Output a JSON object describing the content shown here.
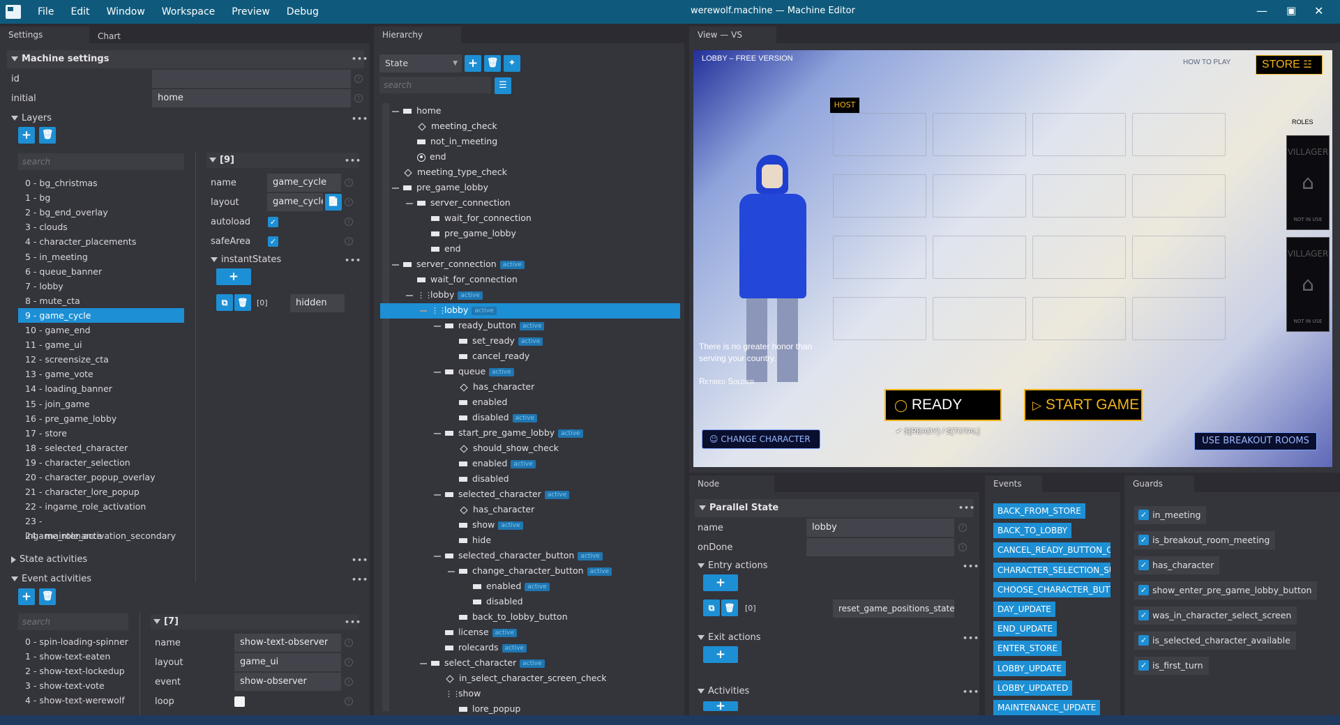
{
  "app": {
    "title": "werewolf.machine — Machine Editor",
    "menu": [
      "File",
      "Edit",
      "Window",
      "Workspace",
      "Preview",
      "Debug"
    ]
  },
  "left": {
    "tabs": [
      "Settings",
      "Chart"
    ],
    "section": "Machine settings",
    "id_label": "id",
    "id_value": "",
    "initial_label": "initial",
    "initial_value": "home",
    "layers_title": "Layers",
    "search_placeholder": "search",
    "layers": [
      "0 - bg_christmas",
      "1 - bg",
      "2 - bg_end_overlay",
      "3 - clouds",
      "4 - character_placements",
      "5 - in_meeting",
      "6 - queue_banner",
      "7 - lobby",
      "8 - mute_cta",
      "9 - game_cycle",
      "10 - game_end",
      "11 - game_ui",
      "12 - screensize_cta",
      "13 - game_vote",
      "14 - loading_banner",
      "15 - join_game",
      "16 - pre_game_lobby",
      "17 - store",
      "18 - selected_character",
      "19 - character_selection",
      "20 - character_popup_overlay",
      "21 - character_lore_popup",
      "22 - ingame_role_activation",
      "23 - ingame_role_activation_secondary",
      "24 - maintenance"
    ],
    "layer_detail": {
      "index": "[9]",
      "name_label": "name",
      "name_value": "game_cycle",
      "layout_label": "layout",
      "layout_value": "game_cycle.",
      "autoload_label": "autoload",
      "safearea_label": "safeArea",
      "instant_label": "instantStates",
      "instant_index": "[0]",
      "instant_value": "hidden"
    },
    "state_activities": "State activities",
    "event_activities": "Event activities",
    "event_list": [
      "0 - spin-loading-spinner",
      "1 - show-text-eaten",
      "2 - show-text-lockedup",
      "3 - show-text-vote",
      "4 - show-text-werewolf"
    ],
    "event_detail": {
      "index": "[7]",
      "name_label": "name",
      "name_value": "show-text-observer",
      "layout_label": "layout",
      "layout_value": "game_ui",
      "event_label": "event",
      "event_value": "show-observer",
      "loop_label": "loop"
    }
  },
  "hierarchy": {
    "tab": "Hierarchy",
    "select": "State",
    "search_placeholder": "search",
    "nodes": [
      {
        "t": "home",
        "d": 0,
        "i": "box",
        "c": "min"
      },
      {
        "t": "meeting_check",
        "d": 1,
        "i": "dia"
      },
      {
        "t": "not_in_meeting",
        "d": 1,
        "i": "box"
      },
      {
        "t": "end",
        "d": 1,
        "i": "fin"
      },
      {
        "t": "meeting_type_check",
        "d": 0,
        "i": "dia"
      },
      {
        "t": "pre_game_lobby",
        "d": 0,
        "i": "box",
        "c": "min"
      },
      {
        "t": "server_connection",
        "d": 1,
        "i": "box",
        "c": "min"
      },
      {
        "t": "wait_for_connection",
        "d": 2,
        "i": "box"
      },
      {
        "t": "pre_game_lobby",
        "d": 2,
        "i": "box"
      },
      {
        "t": "end",
        "d": 2,
        "i": "box"
      },
      {
        "t": "server_connection",
        "d": 0,
        "i": "box",
        "c": "min",
        "b": "active"
      },
      {
        "t": "wait_for_connection",
        "d": 1,
        "i": "box"
      },
      {
        "t": "lobby",
        "d": 1,
        "i": "par",
        "c": "min",
        "b": "active"
      },
      {
        "t": "lobby",
        "d": 2,
        "i": "par",
        "c": "min",
        "b": "active",
        "sel": true
      },
      {
        "t": "ready_button",
        "d": 3,
        "i": "box",
        "c": "min",
        "b": "active"
      },
      {
        "t": "set_ready",
        "d": 4,
        "i": "box",
        "b": "active"
      },
      {
        "t": "cancel_ready",
        "d": 4,
        "i": "box"
      },
      {
        "t": "queue",
        "d": 3,
        "i": "box",
        "c": "min",
        "b": "active"
      },
      {
        "t": "has_character",
        "d": 4,
        "i": "dia"
      },
      {
        "t": "enabled",
        "d": 4,
        "i": "box"
      },
      {
        "t": "disabled",
        "d": 4,
        "i": "box",
        "b": "active"
      },
      {
        "t": "start_pre_game_lobby",
        "d": 3,
        "i": "box",
        "c": "min",
        "b": "active"
      },
      {
        "t": "should_show_check",
        "d": 4,
        "i": "dia"
      },
      {
        "t": "enabled",
        "d": 4,
        "i": "box",
        "b": "active"
      },
      {
        "t": "disabled",
        "d": 4,
        "i": "box"
      },
      {
        "t": "selected_character",
        "d": 3,
        "i": "box",
        "c": "min",
        "b": "active"
      },
      {
        "t": "has_character",
        "d": 4,
        "i": "dia"
      },
      {
        "t": "show",
        "d": 4,
        "i": "box",
        "b": "active"
      },
      {
        "t": "hide",
        "d": 4,
        "i": "box"
      },
      {
        "t": "selected_character_button",
        "d": 3,
        "i": "box",
        "c": "min",
        "b": "active"
      },
      {
        "t": "change_character_button",
        "d": 4,
        "i": "box",
        "c": "min",
        "b": "active"
      },
      {
        "t": "enabled",
        "d": 5,
        "i": "box",
        "b": "active"
      },
      {
        "t": "disabled",
        "d": 5,
        "i": "box"
      },
      {
        "t": "back_to_lobby_button",
        "d": 4,
        "i": "box"
      },
      {
        "t": "license",
        "d": 3,
        "i": "box",
        "b": "active"
      },
      {
        "t": "rolecards",
        "d": 3,
        "i": "box",
        "b": "active"
      },
      {
        "t": "select_character",
        "d": 2,
        "i": "box",
        "c": "min",
        "b": "active"
      },
      {
        "t": "in_select_character_screen_check",
        "d": 3,
        "i": "dia"
      },
      {
        "t": "show",
        "d": 3,
        "i": "par"
      },
      {
        "t": "lore_popup",
        "d": 4,
        "i": "box"
      }
    ]
  },
  "view": {
    "tab": "View — VS",
    "game": {
      "lobby": "LOBBY – FREE VERSION",
      "howto": "HOW TO PLAY",
      "store": "STORE",
      "host": "HOST",
      "roles": "ROLES",
      "villager": "VILLAGER",
      "not_in_use": "NOT IN USE",
      "quote1": "There is no greater honor than",
      "quote2": "serving your country.",
      "quote_author": "Retired Soldier",
      "ready": "READY",
      "start": "START GAME",
      "ready_count": "${READY} / ${TOTAL}",
      "change": "CHANGE CHARACTER",
      "breakout": "USE BREAKOUT ROOMS"
    }
  },
  "node": {
    "tab": "Node",
    "section": "Parallel State",
    "name_label": "name",
    "name_value": "lobby",
    "ondone_label": "onDone",
    "entry": "Entry actions",
    "entry_index": "[0]",
    "entry_value": "reset_game_positions_state",
    "exit": "Exit actions",
    "activities": "Activities"
  },
  "events": {
    "tab": "Events",
    "items": [
      "BACK_FROM_STORE",
      "BACK_TO_LOBBY",
      "CANCEL_READY_BUTTON_CL",
      "CHARACTER_SELECTION_SU",
      "CHOOSE_CHARACTER_BUTT",
      "DAY_UPDATE",
      "END_UPDATE",
      "ENTER_STORE",
      "LOBBY_UPDATE",
      "LOBBY_UPDATED",
      "MAINTENANCE_UPDATE"
    ]
  },
  "guards": {
    "tab": "Guards",
    "items": [
      "in_meeting",
      "is_breakout_room_meeting",
      "has_character",
      "show_enter_pre_game_lobby_button",
      "was_in_character_select_screen",
      "is_selected_character_available",
      "is_first_turn"
    ]
  },
  "colors": {
    "accent": "#1d8fd4",
    "titlebar": "#0f5a7c",
    "panel": "#34343b",
    "game_button": "#f2b41c"
  }
}
